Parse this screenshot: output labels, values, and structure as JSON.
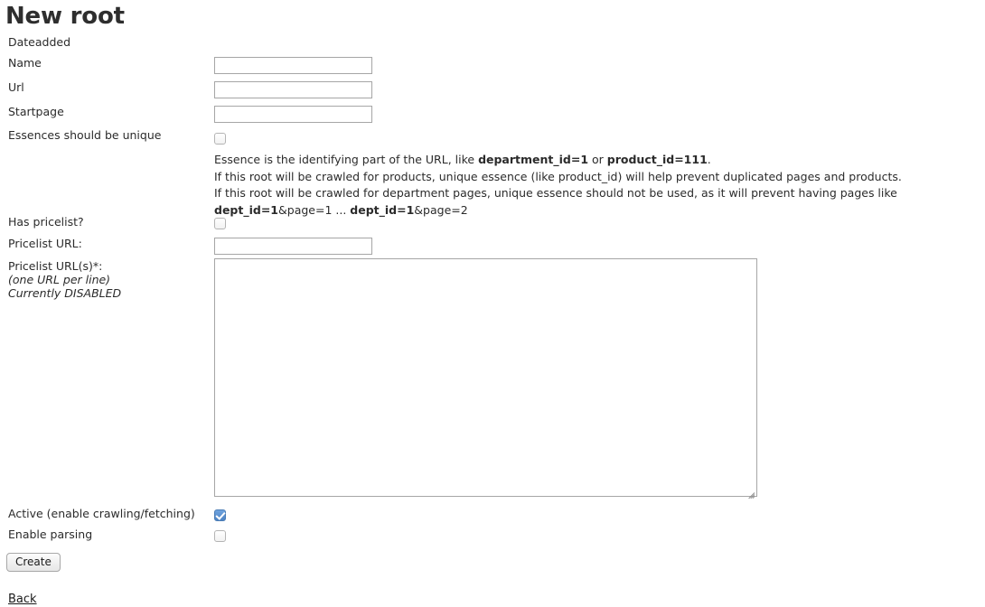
{
  "page": {
    "title": "New root"
  },
  "form": {
    "fields": {
      "dateadded": {
        "label": "Dateadded"
      },
      "name": {
        "label": "Name",
        "value": "",
        "placeholder": ""
      },
      "url": {
        "label": "Url",
        "value": "",
        "placeholder": ""
      },
      "startpage": {
        "label": "Startpage",
        "value": "",
        "placeholder": ""
      },
      "essence_unique": {
        "label": "Essences should be unique",
        "checked": false,
        "note_lines": [
          {
            "parts": [
              {
                "text": "Essence is the identifying part of the URL, like ",
                "bold": false
              },
              {
                "text": "department_id=1",
                "bold": true
              },
              {
                "text": " or ",
                "bold": false
              },
              {
                "text": "product_id=111",
                "bold": true
              },
              {
                "text": ".",
                "bold": false
              }
            ]
          },
          {
            "parts": [
              {
                "text": "If this root will be crawled for products, unique essence (like product_id) will help prevent duplicated pages and products.",
                "bold": false
              }
            ]
          },
          {
            "parts": [
              {
                "text": "If this root will be crawled for department pages, unique essence should not be used, as it will prevent having pages like",
                "bold": false
              }
            ]
          },
          {
            "parts": [
              {
                "text": "dept_id=1",
                "bold": true
              },
              {
                "text": "&page=1 ... ",
                "bold": false
              },
              {
                "text": "dept_id=1",
                "bold": true
              },
              {
                "text": "&page=2",
                "bold": false
              }
            ]
          }
        ]
      },
      "has_pricelist": {
        "label": "Has pricelist?",
        "checked": false
      },
      "pricelist_url": {
        "label": "Pricelist URL:",
        "value": "",
        "placeholder": ""
      },
      "pricelist_urls": {
        "label": "Pricelist URL(s)*:",
        "hint_1": "(one URL per line)",
        "hint_2": "Currently DISABLED",
        "value": "",
        "placeholder": ""
      },
      "active": {
        "label": "Active (enable crawling/fetching)",
        "checked": true
      },
      "enable_parsing": {
        "label": "Enable parsing",
        "checked": false
      }
    },
    "submit_label": "Create"
  },
  "footer": {
    "back_label": "Back"
  },
  "colors": {
    "checkbox_checked": "#4d83c4",
    "text": "#2b2b2b",
    "border": "#a6a6a6",
    "background": "#ffffff"
  }
}
